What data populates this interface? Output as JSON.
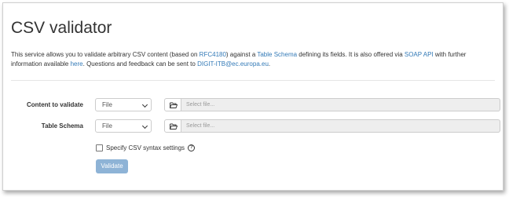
{
  "page": {
    "title": "CSV validator",
    "intro": {
      "t1": "This service allows you to validate arbitrary CSV content (based on ",
      "link_rfc": "RFC4180",
      "t2": ") against a ",
      "link_schema": "Table Schema",
      "t3": " defining its fields. It is also offered via ",
      "link_soap": "SOAP API",
      "t4": " with further information available ",
      "link_here": "here",
      "t5": ". Questions and feedback can be sent to ",
      "link_email": "DIGIT-ITB@ec.europa.eu",
      "t6": "."
    }
  },
  "form": {
    "content": {
      "label": "Content to validate",
      "type_value": "File",
      "file_placeholder": "Select file..."
    },
    "schema": {
      "label": "Table Schema",
      "type_value": "File",
      "file_placeholder": "Select file..."
    },
    "syntax_settings_label": "Specify CSV syntax settings",
    "help_icon": "question-circle-icon",
    "validate_label": "Validate"
  },
  "colors": {
    "link": "#337ab7",
    "validate_button": "#8eb3d6"
  }
}
